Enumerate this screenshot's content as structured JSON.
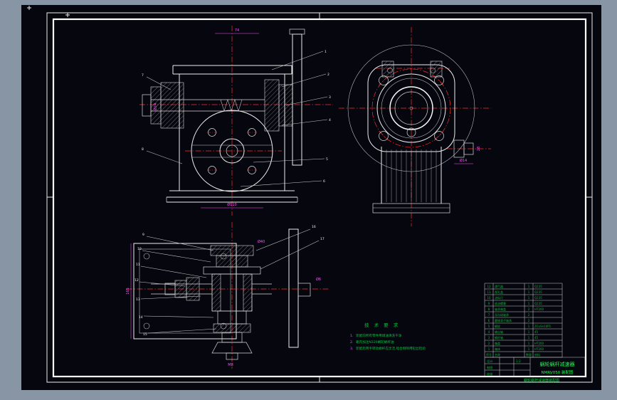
{
  "app": {
    "background_color": "#8795a5",
    "canvas_color": "#05060e",
    "line_color": "#ededed",
    "centerline_color": "#ff2d2d",
    "dimension_color": "#ff4fff",
    "annotation_color": "#05b92f",
    "title_color": "#1aff4e"
  },
  "dims": {
    "v1_top": "74",
    "v1_left": "Ø24",
    "v1_bottom": "Ø110",
    "v2_dia": "Ø14",
    "v2_len": "28",
    "v3_height": "165",
    "v3_top": "Ø40",
    "v3_right": "Ø6",
    "v3_bottom": "M8"
  },
  "balloons": [
    "1",
    "2",
    "3",
    "4",
    "5",
    "6",
    "7",
    "8",
    "9",
    "10",
    "11",
    "12",
    "13",
    "14",
    "15",
    "16",
    "17"
  ],
  "notes": {
    "title": "技 术 要 求",
    "items": [
      {
        "no": "1.",
        "text": "装配前所有零件用煤油清洗干净"
      },
      {
        "no": "2.",
        "text": "箱内加注N320蜗轮蜗杆油"
      },
      {
        "no": "3.",
        "text": "装配后用手转动蜗杆应灵活,啮合侧隙用铅丝检验"
      }
    ]
  },
  "bom": {
    "header": {
      "no": "序号",
      "name": "名称",
      "qty": "数量",
      "mat": "材料"
    },
    "rows": [
      {
        "no": "12",
        "name": "通气器",
        "qty": "1",
        "mat": "Q235"
      },
      {
        "no": "11",
        "name": "视孔盖",
        "qty": "1",
        "mat": "Q235"
      },
      {
        "no": "10",
        "name": "油标尺",
        "qty": "1",
        "mat": "Q235"
      },
      {
        "no": "9",
        "name": "放油螺塞",
        "qty": "1",
        "mat": "Q235"
      },
      {
        "no": "8",
        "name": "轴承端盖",
        "qty": "2",
        "mat": "HT200"
      },
      {
        "no": "7",
        "name": "深沟球轴承",
        "qty": "2",
        "mat": ""
      },
      {
        "no": "6",
        "name": "圆锥滚子轴承",
        "qty": "2",
        "mat": ""
      },
      {
        "no": "5",
        "name": "蜗轮",
        "qty": "1",
        "mat": "ZCuSn10P1"
      },
      {
        "no": "4",
        "name": "输出轴",
        "qty": "1",
        "mat": "45"
      },
      {
        "no": "3",
        "name": "蜗杆轴",
        "qty": "1",
        "mat": "45"
      },
      {
        "no": "2",
        "name": "箱盖",
        "qty": "1",
        "mat": "HT200"
      },
      {
        "no": "1",
        "name": "箱体",
        "qty": "1",
        "mat": "HT200"
      }
    ]
  },
  "title_block": {
    "design": "设计",
    "draft": "制图",
    "check": "校核",
    "scale": "1:2",
    "product": "蜗轮蜗杆减速器",
    "code": "NMRV050 装配图",
    "footer": "蜗轮蜗杆减速器装配图"
  }
}
